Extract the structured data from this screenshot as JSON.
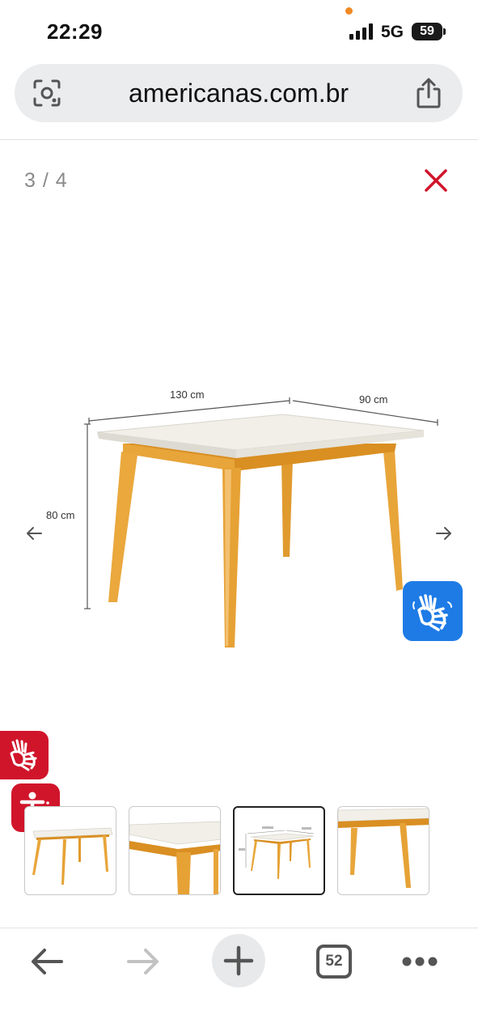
{
  "status_bar": {
    "time": "22:29",
    "network": "5G",
    "battery": "59"
  },
  "browser": {
    "url": "americanas.com.br",
    "icons": [
      "lens-icon",
      "share-icon"
    ]
  },
  "gallery": {
    "counter": "3 / 4",
    "dimensions": {
      "width": "130 cm",
      "depth": "90 cm",
      "height": "80 cm"
    },
    "thumbnail_count": 4,
    "active_thumbnail": 3
  },
  "toolbar": {
    "tabs_count": "52"
  },
  "colors": {
    "close": "#d0152b",
    "libras_blue": "#1e7be6",
    "accessibility_red": "#d0152b",
    "wood": "#e8a53a",
    "tabletop": "#f1efe8"
  }
}
